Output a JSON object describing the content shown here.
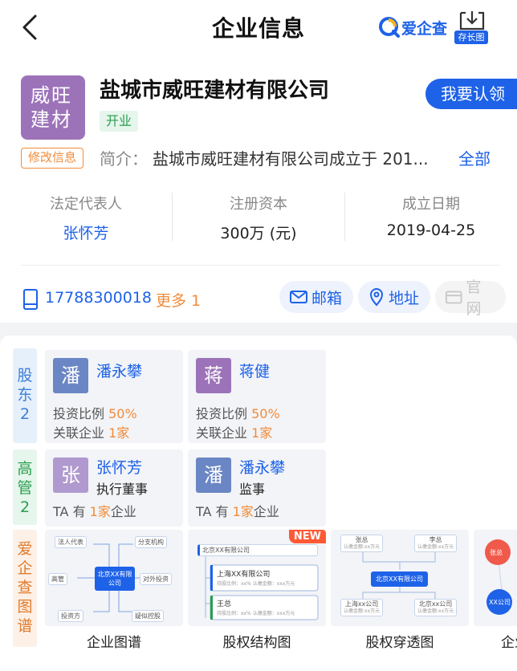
{
  "nav": {
    "title": "企业信息",
    "brand": "爱企查",
    "save_long": "存长图"
  },
  "company": {
    "logo_text_line1": "威旺",
    "logo_text_line2": "建材",
    "name": "盐城市威旺建材有限公司",
    "status": "开业",
    "claim_button": "我要认领",
    "edit_tag": "修改信息",
    "intro_label": "简介：",
    "intro_text": "盐城市威旺建材有限公司成立于 201...",
    "intro_more": "全部",
    "logo_color": "#9c73b9"
  },
  "stats": [
    {
      "label": "法定代表人",
      "value": "张怀芳"
    },
    {
      "label": "注册资本",
      "value": "300万 (元)"
    },
    {
      "label": "成立日期",
      "value": "2019-04-25"
    }
  ],
  "contact": {
    "phone": "17788300018",
    "phone_more": "更多 1",
    "email_label": "邮箱",
    "address_label": "地址",
    "website_label": "官网"
  },
  "shareholders": {
    "tab_label": "股东",
    "count": "2",
    "items": [
      {
        "avatar": "潘",
        "name": "潘永攀",
        "ratio_label": "投资比例",
        "ratio": "50%",
        "related_label": "关联企业",
        "related": "1家",
        "color": "#6b86c4"
      },
      {
        "avatar": "蒋",
        "name": "蒋健",
        "ratio_label": "投资比例",
        "ratio": "50%",
        "related_label": "关联企业",
        "related": "1家",
        "color": "#9c73b9"
      }
    ]
  },
  "executives": {
    "tab_label": "高管",
    "count": "2",
    "items": [
      {
        "avatar": "张",
        "name": "张怀芳",
        "role": "执行董事",
        "ta_label": "TA 有",
        "ta_count": "1家",
        "ta_suffix": "企业",
        "color": "#b099cf"
      },
      {
        "avatar": "潘",
        "name": "潘永攀",
        "role": "监事",
        "ta_label": "TA 有",
        "ta_count": "1家",
        "ta_suffix": "企业",
        "color": "#6b86c4"
      }
    ]
  },
  "graphs": {
    "tab_label": "爱企查图谱",
    "items": [
      {
        "label": "企业图谱"
      },
      {
        "label": "股权结构图",
        "badge": "NEW"
      },
      {
        "label": "股权穿透图"
      },
      {
        "label": "企业"
      }
    ],
    "map1": {
      "center": "北京XX有限公司",
      "nodes": [
        "法人代表",
        "分支机构",
        "高管",
        "对外投资",
        "投资方",
        "疑似控股"
      ]
    },
    "map2": {
      "root": "北京XX有限公司",
      "child": "上海XX有限公司",
      "child_detail": "持股比例：xx%   认缴金额：xxx万元",
      "person": "王总",
      "person_detail": "持股比例：xx%   认缴金额：xxx万元"
    },
    "map3": {
      "top_left": "张总",
      "top_left_detail": "认缴金额:xx万元",
      "top_right": "李总",
      "top_right_detail": "认缴金额:xx万元",
      "center": "北京XX有限公司",
      "bottom_left": "上海xx公司",
      "bottom_left_detail": "认缴金额:xx万元",
      "bottom_right": "北京xx公司",
      "bottom_right_detail": "认缴金额:xx万元"
    },
    "map4": {
      "node1": "张总",
      "node2": "XX公司"
    }
  }
}
